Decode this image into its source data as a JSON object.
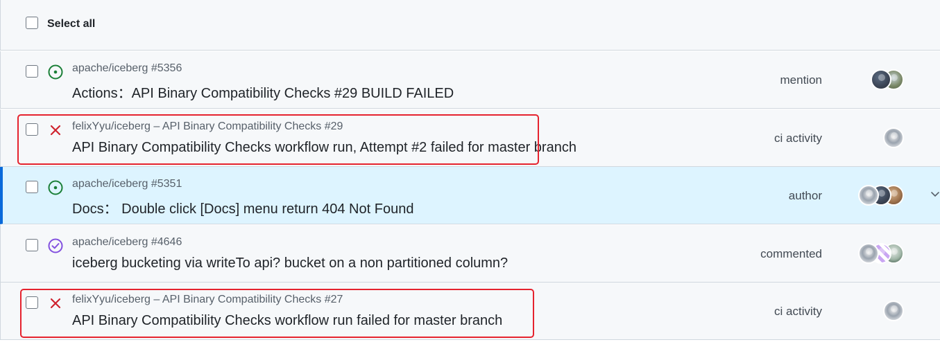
{
  "header": {
    "select_all_label": "Select all"
  },
  "rows": [
    {
      "repo": "apache/iceberg #5356",
      "title": "Actions：API Binary Compatibility Checks #29 BUILD FAILED",
      "reason": "mention",
      "status_icon": "issue-open-icon",
      "status_color": "#1a7f37"
    },
    {
      "repo": "felixYyu/iceberg – API Binary Compatibility Checks #29",
      "title": "API Binary Compatibility Checks workflow run, Attempt #2 failed for master branch",
      "reason": "ci activity",
      "status_icon": "x-icon",
      "status_color": "#cf222e"
    },
    {
      "repo": "apache/iceberg #5351",
      "title": "Docs： Double click [Docs] menu return 404 Not Found",
      "reason": "author",
      "status_icon": "issue-open-icon",
      "status_color": "#1a7f37"
    },
    {
      "repo": "apache/iceberg #4646",
      "title": "iceberg bucketing via writeTo api? bucket on a non partitioned column?",
      "reason": "commented",
      "status_icon": "issue-closed-icon",
      "status_color": "#8250df"
    },
    {
      "repo": "felixYyu/iceberg – API Binary Compatibility Checks #27",
      "title": "API Binary Compatibility Checks workflow run failed for master branch",
      "reason": "ci activity",
      "status_icon": "x-icon",
      "status_color": "#cf222e"
    }
  ],
  "colors": {
    "accent": "#0969da",
    "selected_row_bg": "#ddf4ff",
    "highlight_box": "#e5222e"
  }
}
